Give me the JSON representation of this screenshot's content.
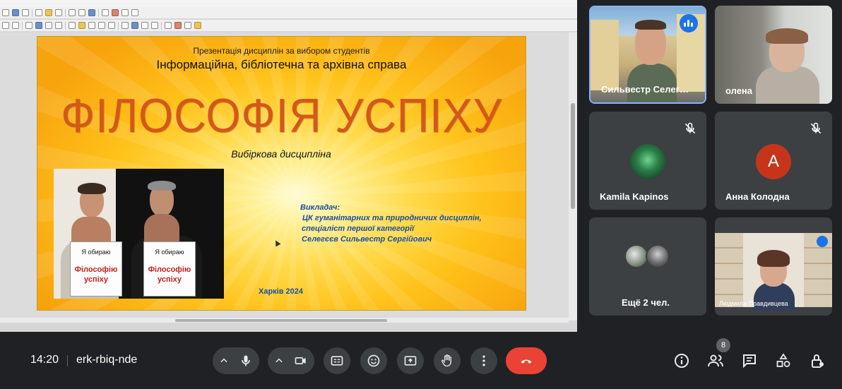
{
  "slide": {
    "header": "Презентація дисциплін за вибором студентів",
    "subtitle": "Інформаційна, бібліотечна та архівна справа",
    "title": "ФІЛОСОФІЯ УСПІХУ",
    "kind": "Вибіркова дисципліна",
    "teacher_label": "Викладач:",
    "teacher_dept": "ЦК гуманітарних та природничих дисциплін,",
    "teacher_rank": "спеціаліст першої категорії",
    "teacher_name": "Селегєєв Сильвестр Сергійович",
    "city": "Харків 2024",
    "sign_line1": "Я обираю",
    "sign_line2": "Філософію успіху"
  },
  "participants": [
    {
      "name": "Сильвестр Селег…",
      "speaking": true
    },
    {
      "name": "олена"
    },
    {
      "name": "Kamila Kapinos",
      "muted": true
    },
    {
      "name": "Анна Колодна",
      "muted": true,
      "avatar_letter": "А"
    },
    {
      "name": "Ещё 2 чел."
    },
    {
      "name": "Людмила Правдивцева"
    }
  ],
  "bottom_bar": {
    "time": "14:20",
    "meeting_code": "erk-rbiq-nde",
    "people_count": "8",
    "icons": [
      "chevron-up-icon",
      "mic-icon",
      "chevron-up-icon",
      "camera-icon",
      "captions-icon",
      "emoji-icon",
      "present-icon",
      "raise-hand-icon",
      "more-icon",
      "end-call-icon",
      "info-icon",
      "people-icon",
      "chat-icon",
      "activities-icon",
      "host-controls-icon"
    ]
  },
  "colors": {
    "accent_blue": "#8ab4f8",
    "end_call_red": "#ea4335",
    "slide_title_orange": "#d4581a",
    "teacher_blue": "#1a4fa0"
  }
}
